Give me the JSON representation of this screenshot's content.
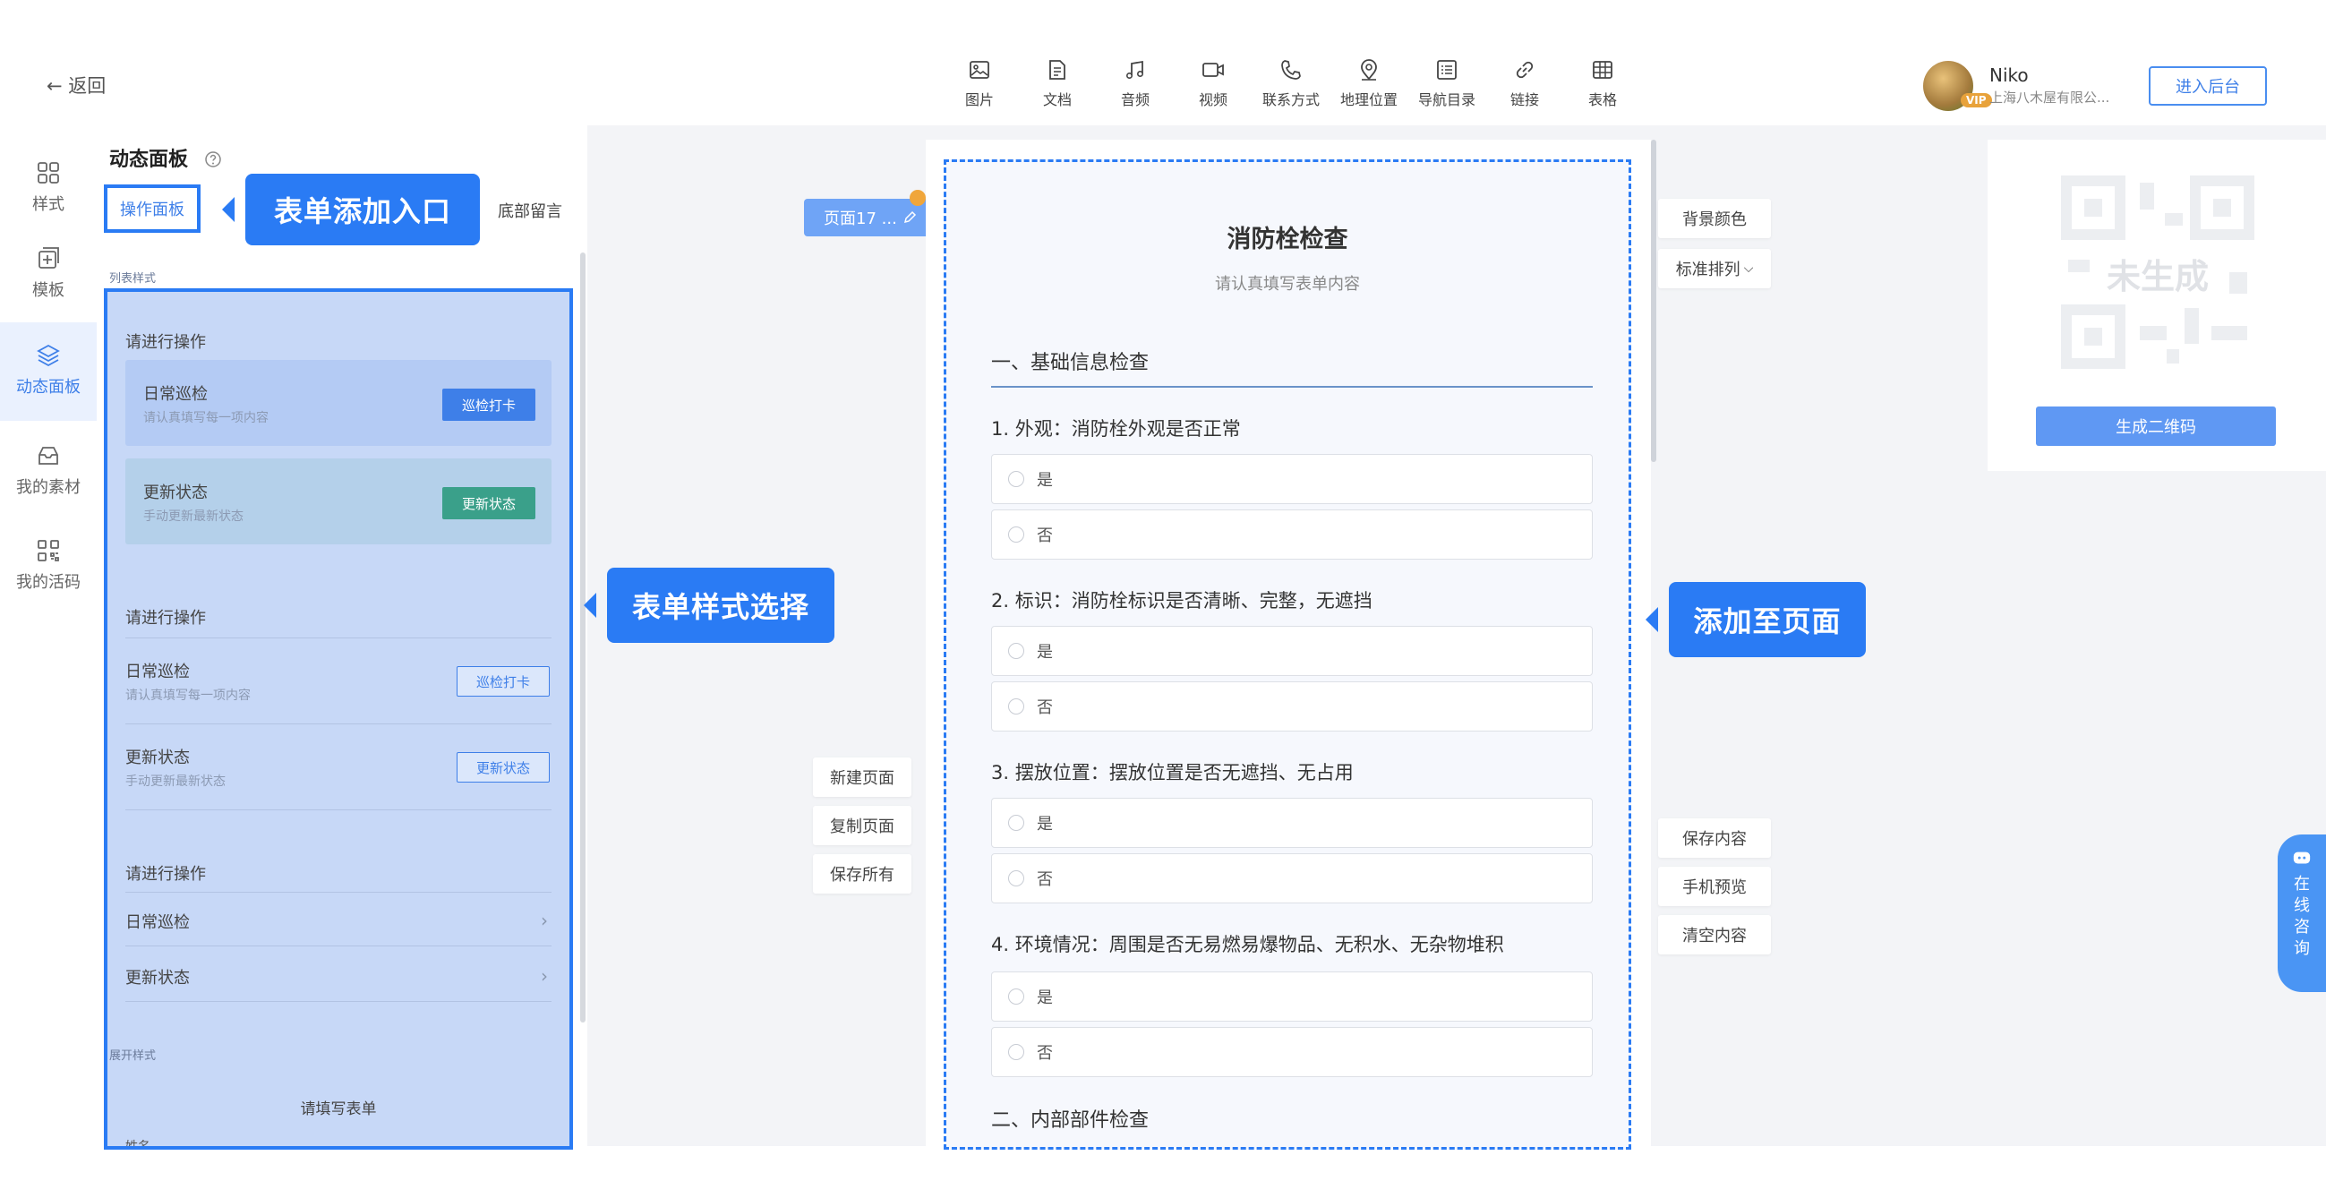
{
  "topbar": {
    "back_label": "← 返回",
    "tools": [
      {
        "label": "图片",
        "icon": "image-icon"
      },
      {
        "label": "文档",
        "icon": "document-icon"
      },
      {
        "label": "音频",
        "icon": "music-icon"
      },
      {
        "label": "视频",
        "icon": "video-icon"
      },
      {
        "label": "联系方式",
        "icon": "phone-icon"
      },
      {
        "label": "地理位置",
        "icon": "location-icon"
      },
      {
        "label": "导航目录",
        "icon": "list-icon"
      },
      {
        "label": "链接",
        "icon": "link-icon"
      },
      {
        "label": "表格",
        "icon": "table-icon"
      }
    ],
    "user_name": "Niko",
    "user_badge": "VIP",
    "user_company": "上海八木屋有限公...",
    "admin_button": "进入后台"
  },
  "leftnav": {
    "items": [
      {
        "label": "样式",
        "icon": "grid-icon"
      },
      {
        "label": "模板",
        "icon": "template-icon"
      },
      {
        "label": "动态面板",
        "icon": "layers-icon"
      },
      {
        "label": "我的素材",
        "icon": "inbox-icon"
      },
      {
        "label": "我的活码",
        "icon": "qr-icon"
      }
    ],
    "active_index": 2
  },
  "panel": {
    "title": "动态面板",
    "tab_active": "操作面板",
    "tab_other": "底部留言",
    "callout_add_entry": "表单添加入口",
    "callout_style_select": "表单样式选择",
    "preview": {
      "section1_label": "列表样式",
      "group1_title": "请进行操作",
      "card1_title": "日常巡检",
      "card1_sub": "请认真填写每一项内容",
      "card1_btn": "巡检打卡",
      "card2_title": "更新状态",
      "card2_sub": "手动更新最新状态",
      "card2_btn": "更新状态",
      "group2_title": "请进行操作",
      "row1_title": "日常巡检",
      "row1_sub": "请认真填写每一项内容",
      "row1_btn": "巡检打卡",
      "row2_title": "更新状态",
      "row2_sub": "手动更新最新状态",
      "row2_btn": "更新状态",
      "group3_title": "请进行操作",
      "item1": "日常巡检",
      "item2": "更新状态",
      "section2_label": "展开样式",
      "expand_title": "请填写表单",
      "expand_cut": "姓名"
    }
  },
  "page_ops": {
    "page_tag": "页面17 ...",
    "new_page": "新建页面",
    "copy_page": "复制页面",
    "save_all": "保存所有"
  },
  "form": {
    "title": "消防栓检查",
    "subtitle": "请认真填写表单内容",
    "section1": "一、基础信息检查",
    "section2": "二、内部部件检查",
    "questions": [
      {
        "q": "1. 外观：消防栓外观是否正常",
        "opts": [
          "是",
          "否"
        ]
      },
      {
        "q": "2. 标识：消防栓标识是否清晰、完整，无遮挡",
        "opts": [
          "是",
          "否"
        ]
      },
      {
        "q": "3. 摆放位置：摆放位置是否无遮挡、无占用",
        "opts": [
          "是",
          "否"
        ]
      },
      {
        "q": "4. 环境情况：周围是否无易燃易爆物品、无积水、无杂物堆积",
        "opts": [
          "是",
          "否"
        ]
      }
    ]
  },
  "right": {
    "bg_color": "背景颜色",
    "layout": "标准排列",
    "callout_add_page": "添加至页面",
    "save_content": "保存内容",
    "phone_preview": "手机预览",
    "clear_content": "清空内容",
    "qr_placeholder": "未生成",
    "gen_qr": "生成二维码",
    "consult": [
      "在",
      "线",
      "咨",
      "询"
    ]
  },
  "colors": {
    "accent": "#2a7bf4",
    "button": "#5f98f3",
    "green": "#3aa08a"
  }
}
